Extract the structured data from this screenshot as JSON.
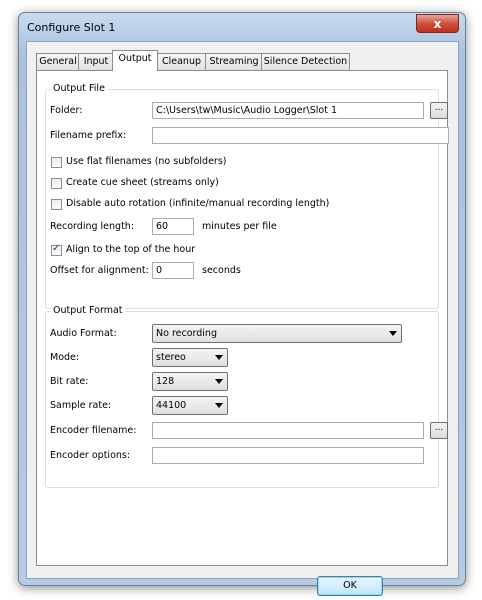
{
  "window": {
    "title": "Configure Slot 1",
    "close_glyph": "x"
  },
  "tabs": [
    "General",
    "Input",
    "Output",
    "Cleanup",
    "Streaming",
    "Silence Detection"
  ],
  "active_tab": "Output",
  "output_file": {
    "legend": "Output File",
    "folder_label": "Folder:",
    "folder_value": "C:\\Users\\tw\\Music\\Audio Logger\\Slot 1",
    "browse_label": "...",
    "prefix_label": "Filename prefix:",
    "prefix_value": "",
    "flat_label": "Use flat filenames (no subfolders)",
    "flat_checked": false,
    "cue_label": "Create cue sheet (streams only)",
    "cue_checked": false,
    "rotation_label": "Disable auto rotation (infinite/manual recording length)",
    "rotation_checked": false,
    "length_label": "Recording length:",
    "length_value": "60",
    "length_unit": "minutes per file",
    "align_label": "Align to the top of the hour",
    "align_checked": true,
    "offset_label": "Offset for alignment:",
    "offset_value": "0",
    "offset_unit": "seconds"
  },
  "output_format": {
    "legend": "Output Format",
    "audio_format_label": "Audio Format:",
    "audio_format_value": "No recording",
    "mode_label": "Mode:",
    "mode_value": "stereo",
    "bitrate_label": "Bit rate:",
    "bitrate_value": "128",
    "samplerate_label": "Sample rate:",
    "samplerate_value": "44100",
    "encoder_filename_label": "Encoder filename:",
    "encoder_filename_value": "",
    "browse_label": "...",
    "encoder_options_label": "Encoder options:",
    "encoder_options_value": ""
  },
  "ok_label": "OK"
}
